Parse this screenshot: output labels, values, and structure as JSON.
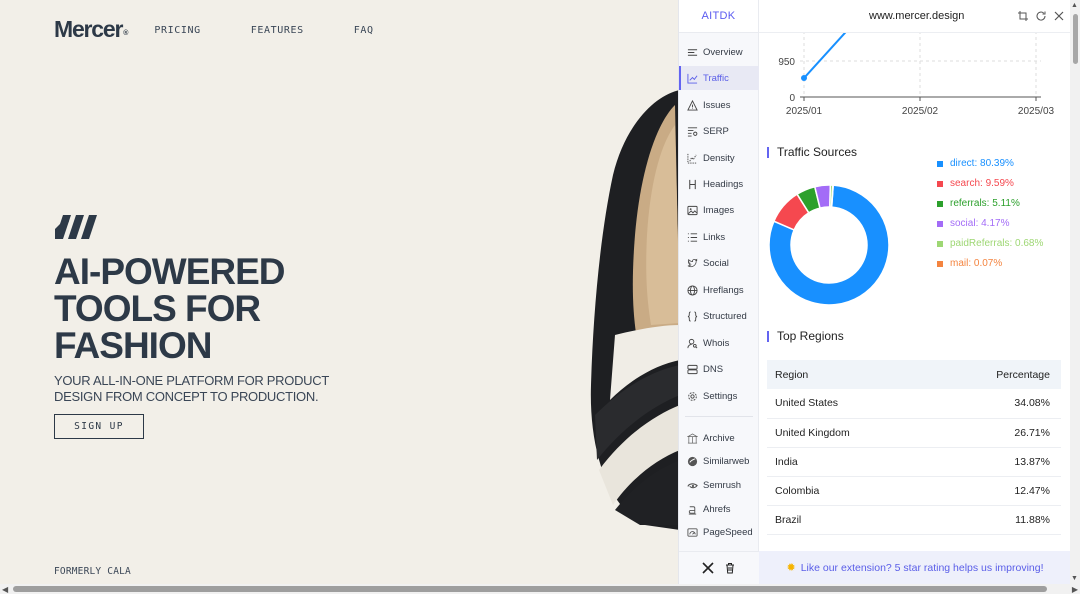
{
  "site": {
    "logo": "Mercer",
    "logo_mark": "®",
    "nav": [
      "PRICING",
      "FEATURES",
      "FAQ"
    ],
    "hero_lines": [
      "AI-POWERED",
      "TOOLS FOR",
      "FASHION"
    ],
    "subtitle_lines": [
      "YOUR ALL-IN-ONE PLATFORM FOR PRODUCT",
      "DESIGN FROM CONCEPT TO PRODUCTION."
    ],
    "cta": "SIGN UP",
    "footer_note": "FORMERLY CALA"
  },
  "panel": {
    "brand": "AITDK",
    "domain": "www.mercer.design",
    "sidebar": [
      {
        "label": "Overview",
        "icon": "list-icon"
      },
      {
        "label": "Traffic",
        "icon": "chart-icon",
        "active": true
      },
      {
        "label": "Issues",
        "icon": "warning-icon"
      },
      {
        "label": "SERP",
        "icon": "serp-icon"
      },
      {
        "label": "Density",
        "icon": "density-icon"
      },
      {
        "label": "Headings",
        "icon": "heading-icon"
      },
      {
        "label": "Images",
        "icon": "image-icon"
      },
      {
        "label": "Links",
        "icon": "links-icon"
      },
      {
        "label": "Social",
        "icon": "twitter-icon"
      },
      {
        "label": "Hreflangs",
        "icon": "globe-icon"
      },
      {
        "label": "Structured",
        "icon": "braces-icon"
      },
      {
        "label": "Whois",
        "icon": "user-search-icon"
      },
      {
        "label": "DNS",
        "icon": "server-icon"
      },
      {
        "label": "Settings",
        "icon": "gear-icon"
      }
    ],
    "sidebar_external": [
      {
        "label": "Archive",
        "icon": "archive-icon"
      },
      {
        "label": "Similarweb",
        "icon": "similarweb-icon"
      },
      {
        "label": "Semrush",
        "icon": "semrush-icon"
      },
      {
        "label": "Ahrefs",
        "icon": "ahrefs-icon"
      },
      {
        "label": "PageSpeed",
        "icon": "pagespeed-icon"
      }
    ],
    "visits_chart": {
      "type": "line",
      "x": [
        "2025/01",
        "2025/02",
        "2025/03"
      ],
      "y_ticks": [
        "950",
        "0"
      ],
      "first_value": 500
    },
    "traffic_sources_title": "Traffic Sources",
    "top_regions_title": "Top Regions",
    "regions_header": {
      "region": "Region",
      "percentage": "Percentage"
    },
    "regions": [
      {
        "region": "United States",
        "percentage": "34.08%"
      },
      {
        "region": "United Kingdom",
        "percentage": "26.71%"
      },
      {
        "region": "India",
        "percentage": "13.87%"
      },
      {
        "region": "Colombia",
        "percentage": "12.47%"
      },
      {
        "region": "Brazil",
        "percentage": "11.88%"
      }
    ],
    "feedback": "Like our extension? 5 star rating helps us improving!"
  },
  "chart_data": {
    "type": "pie",
    "title": "Traffic Sources",
    "categories": [
      "direct",
      "search",
      "referrals",
      "social",
      "paidReferrals",
      "mail"
    ],
    "values": [
      80.39,
      9.59,
      5.11,
      4.17,
      0.68,
      0.07
    ],
    "labels": [
      "direct: 80.39%",
      "search: 9.59%",
      "referrals: 5.11%",
      "social: 4.17%",
      "paidReferrals: 0.68%",
      "mail: 0.07%"
    ],
    "colors": [
      "#1890ff",
      "#f5484f",
      "#2ca02c",
      "#a36cf7",
      "#9ed774",
      "#f4843f"
    ],
    "legend": "right"
  }
}
